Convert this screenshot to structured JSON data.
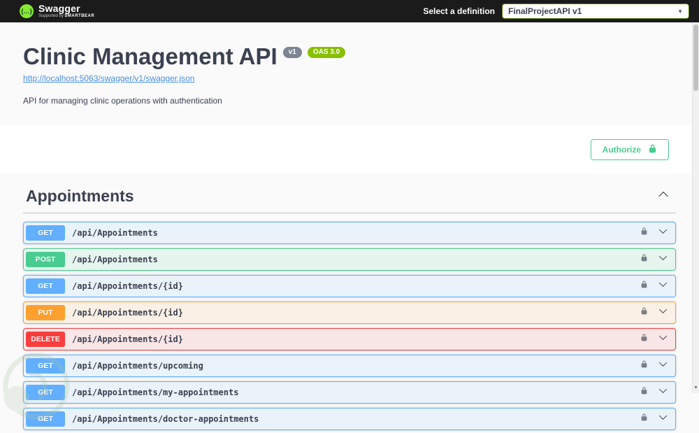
{
  "topbar": {
    "logo_text": "Swagger",
    "logo_sub_prefix": "Supported by",
    "logo_sub_brand": "SMARTBEAR",
    "select_label": "Select a definition",
    "select_value": "FinalProjectAPI v1"
  },
  "info": {
    "title": "Clinic Management API",
    "version_badge": "v1",
    "oas_badge": "OAS 3.0",
    "spec_url": "http://localhost:5063/swagger/v1/swagger.json",
    "description": "API for managing clinic operations with authentication"
  },
  "auth": {
    "authorize_label": "Authorize"
  },
  "section": {
    "title": "Appointments"
  },
  "endpoints": [
    {
      "method": "GET",
      "path": "/api/Appointments"
    },
    {
      "method": "POST",
      "path": "/api/Appointments"
    },
    {
      "method": "GET",
      "path": "/api/Appointments/{id}"
    },
    {
      "method": "PUT",
      "path": "/api/Appointments/{id}"
    },
    {
      "method": "DELETE",
      "path": "/api/Appointments/{id}"
    },
    {
      "method": "GET",
      "path": "/api/Appointments/upcoming"
    },
    {
      "method": "GET",
      "path": "/api/Appointments/my-appointments"
    },
    {
      "method": "GET",
      "path": "/api/Appointments/doctor-appointments"
    }
  ],
  "icons": {
    "select_caret": "▼",
    "scroll_down_arrow": "▼",
    "logo_glyph": "{…}"
  },
  "colors": {
    "get": "#61affe",
    "post": "#49cc90",
    "put": "#fca130",
    "delete": "#f93e3e",
    "topbar": "#1b1b1b",
    "accent_green": "#49cc90",
    "oas_badge": "#89bf04",
    "version_badge": "#7d8492",
    "heading_text": "#3b4151",
    "link": "#4990e2",
    "swagger_logo_green": "#85ea2d"
  }
}
